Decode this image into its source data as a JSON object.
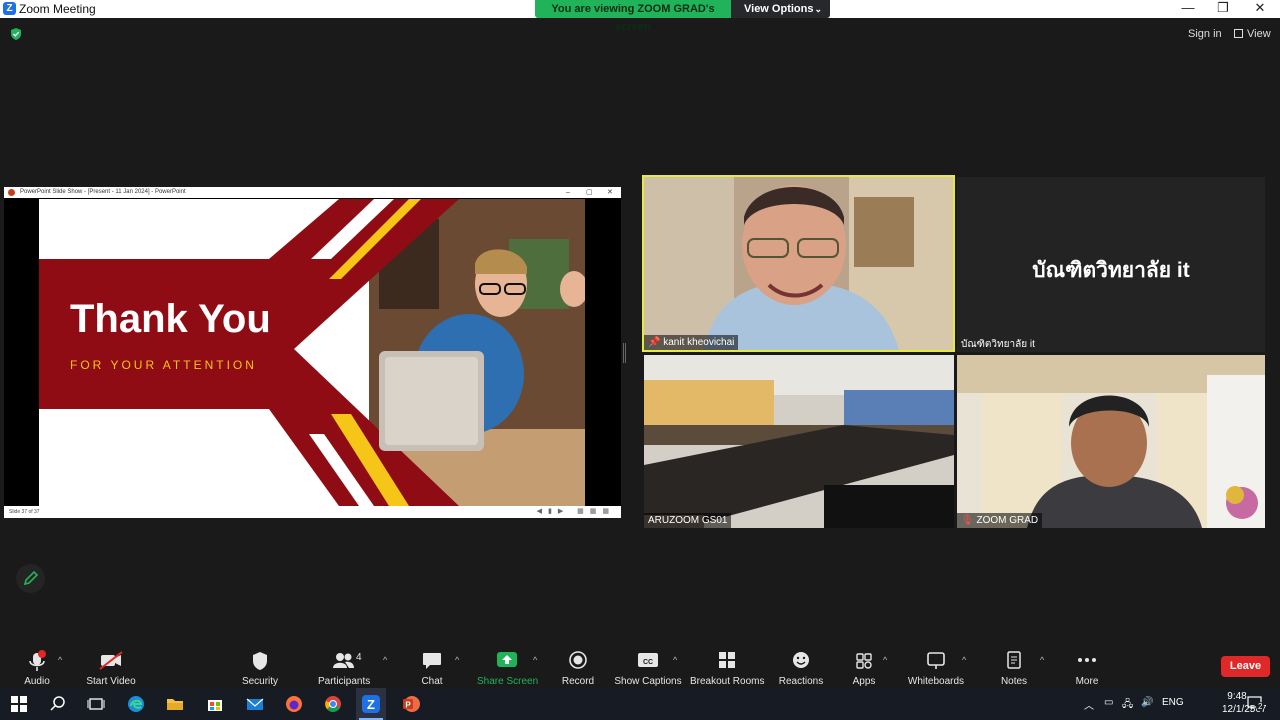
{
  "window": {
    "title": "Zoom Meeting"
  },
  "banner": {
    "viewing": "You are viewing ZOOM GRAD's screen",
    "options": "View Options"
  },
  "topbar": {
    "sign_in": "Sign in",
    "view": "View"
  },
  "shared": {
    "ppt_title": "PowerPoint Slide Show - [Present - 11 Jan 2024] - PowerPoint",
    "slide_heading": "Thank You",
    "slide_subheading": "FOR YOUR ATTENTION",
    "slide_counter": "Slide 37 of 37"
  },
  "participants": [
    {
      "name": "kanit kheovichai",
      "active_speaker": true
    },
    {
      "name": "บัณฑิตวิทยาลัย  it",
      "big_label": "บัณฑิตวิทยาลัย  it"
    },
    {
      "name": "ARUZOOM GS01"
    },
    {
      "name": "ZOOM GRAD"
    }
  ],
  "toolbar": {
    "audio": "Audio",
    "start_video": "Start Video",
    "security": "Security",
    "participants": "Participants",
    "participant_count": "4",
    "chat": "Chat",
    "share_screen": "Share Screen",
    "record": "Record",
    "show_captions": "Show Captions",
    "breakout_rooms": "Breakout Rooms",
    "reactions": "Reactions",
    "apps": "Apps",
    "whiteboards": "Whiteboards",
    "notes": "Notes",
    "more": "More",
    "leave": "Leave"
  },
  "taskbar": {
    "time": "9:48",
    "date": "12/1/2567",
    "language": "ENG",
    "notification_count": "2"
  },
  "colors": {
    "share_green": "#21b35a",
    "active_border": "#e4eb40",
    "leave_red": "#e02828",
    "slide_red": "#8f0c14",
    "slide_gold": "#f5c518"
  }
}
